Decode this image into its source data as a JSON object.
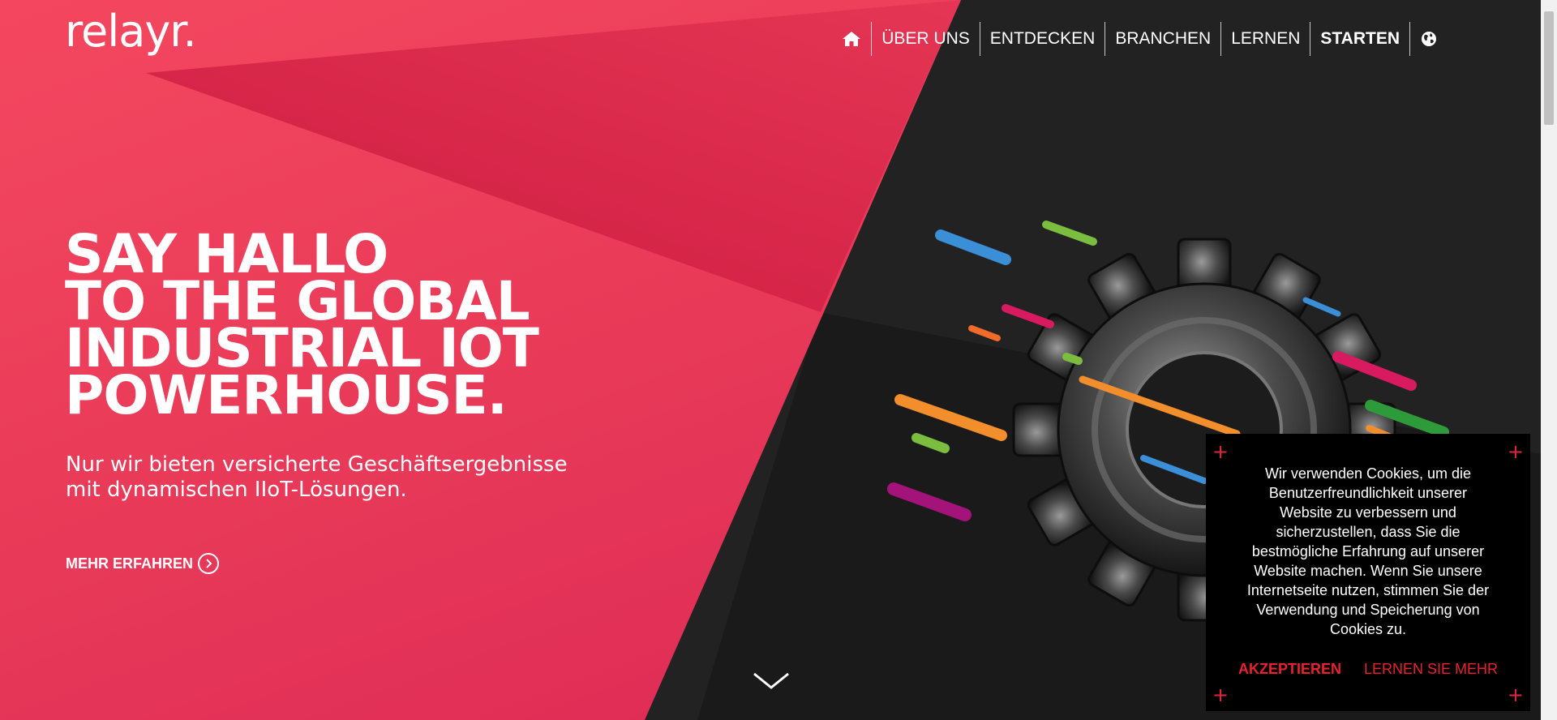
{
  "brand": {
    "logo": "relayr."
  },
  "nav": {
    "items": [
      {
        "label": "ÜBER UNS",
        "bold": false
      },
      {
        "label": "ENTDECKEN",
        "bold": false
      },
      {
        "label": "BRANCHEN",
        "bold": false
      },
      {
        "label": "LERNEN",
        "bold": false
      },
      {
        "label": "STARTEN",
        "bold": true
      }
    ],
    "home_icon": "home-icon",
    "globe_icon": "globe-icon"
  },
  "hero": {
    "headline": [
      "SAY HALLO",
      "TO THE GLOBAL",
      "INDUSTRIAL IOT",
      "POWERHOUSE."
    ],
    "subline": [
      "Nur wir bieten versicherte Geschäftsergebnisse",
      "mit dynamischen IIoT-Lösungen."
    ],
    "cta": "MEHR ERFAHREN"
  },
  "cookie": {
    "text": "Wir verwenden Cookies, um die Benutzerfreundlichkeit unserer Website zu verbessern und sicherzustellen, dass Sie die bestmögliche Erfahrung auf unserer Website machen. Wenn Sie unsere Internetseite nutzen, stimmen Sie der Verwendung und Speicherung von Cookies zu.",
    "accept": "AKZEPTIEREN",
    "learn_more": "LERNEN SIE MEHR"
  },
  "colors": {
    "accent_red": "#e83a58",
    "dark_bg": "#222222",
    "cookie_action": "#e8222f"
  }
}
